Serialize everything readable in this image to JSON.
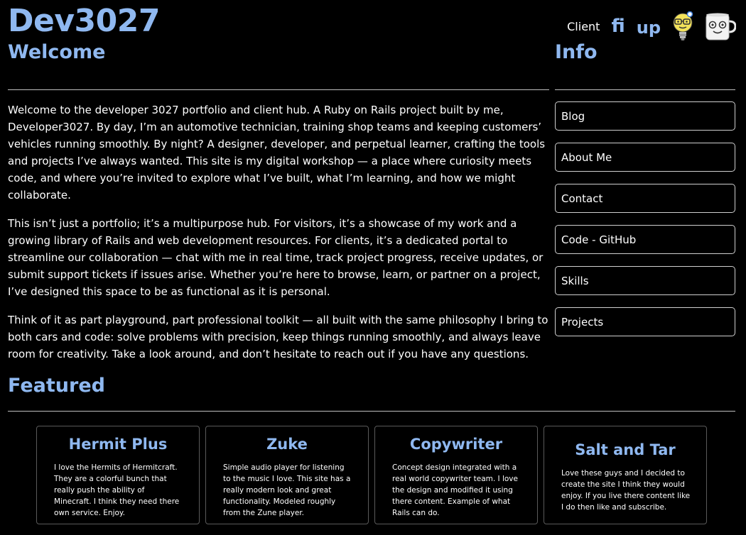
{
  "site": {
    "brand": "Dev3027"
  },
  "header": {
    "client_label": "Client",
    "fiverr_label": "fi",
    "upwork_label": "up",
    "icons": [
      "fiverr-icon",
      "upwork-icon",
      "lightbulb-mascot-icon",
      "coffee-mug-mascot-icon"
    ]
  },
  "welcome": {
    "heading": "Welcome",
    "paragraphs": [
      "Welcome to the developer 3027 portfolio and client hub. A Ruby on Rails project built by me, Developer3027. By day, I’m an automotive technician, training shop teams and keeping customers’ vehicles running smoothly. By night? A designer, developer, and perpetual learner, crafting the tools and projects I’ve always wanted. This site is my digital workshop — a place where curiosity meets code, and where you’re invited to explore what I’ve built, what I’m learning, and how we might collaborate.",
      "This isn’t just a portfolio; it’s a multipurpose hub. For visitors, it’s a showcase of my work and a growing library of Rails and web development resources. For clients, it’s a dedicated portal to streamline our collaboration — chat with me in real time, track project progress, receive updates, or submit support tickets if issues arise. Whether you’re here to browse, learn, or partner on a project, I’ve designed this space to be as functional as it is personal.",
      "Think of it as part playground, part professional toolkit — all built with the same philosophy I bring to both cars and code: solve problems with precision, keep things running smoothly, and always leave room for creativity. Take a look around, and don’t hesitate to reach out if you have any questions."
    ]
  },
  "info": {
    "heading": "Info",
    "links": [
      {
        "label": "Blog"
      },
      {
        "label": "About Me"
      },
      {
        "label": "Contact"
      },
      {
        "label": "Code - GitHub"
      },
      {
        "label": "Skills"
      },
      {
        "label": "Projects"
      }
    ]
  },
  "featured": {
    "heading": "Featured",
    "cards": [
      {
        "title": "Hermit Plus",
        "description": "I love the Hermits of Hermitcraft. They are a colorful bunch that really push the ability of Minecraft. I think they need there own service. Enjoy."
      },
      {
        "title": "Zuke",
        "description": "Simple audio player for listening to the music I love. This site has a really modern look and great functionality. Modeled roughly from the Zune player."
      },
      {
        "title": "Copywriter",
        "description": "Concept design integrated with a real world copywriter team. I love the design and modified it using there content. Example of what Rails can do."
      },
      {
        "title": "Salt and Tar",
        "description": "Love these guys and I decided to create the site I think they would enjoy. If you live there content like I do then like and subscribe."
      }
    ]
  },
  "colors": {
    "background": "#000000",
    "accent": "#8fb8f0",
    "text": "#ffffff",
    "border": "#cfcfcf"
  }
}
